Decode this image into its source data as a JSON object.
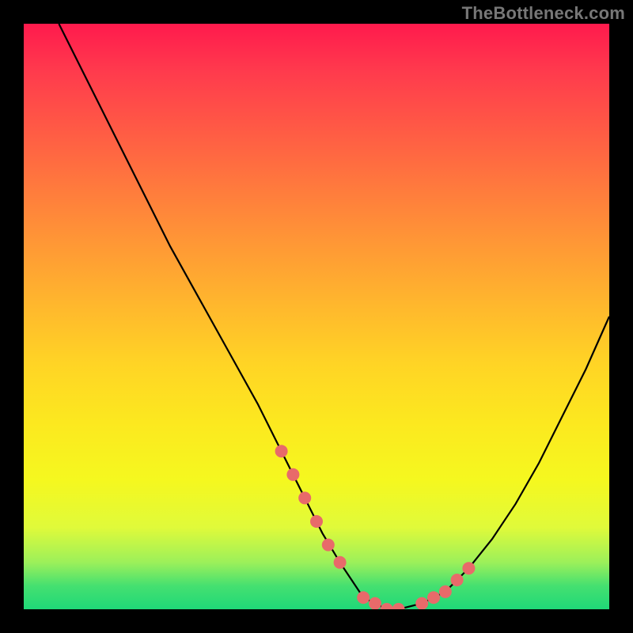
{
  "attribution": "TheBottleneck.com",
  "chart_data": {
    "type": "line",
    "title": "",
    "xlabel": "",
    "ylabel": "",
    "xlim": [
      0,
      100
    ],
    "ylim": [
      0,
      100
    ],
    "series": [
      {
        "name": "curve",
        "x": [
          6,
          10,
          15,
          20,
          25,
          30,
          35,
          40,
          44,
          48,
          51,
          54,
          56,
          58,
          60,
          62,
          64,
          68,
          72,
          76,
          80,
          84,
          88,
          92,
          96,
          100
        ],
        "y": [
          100,
          92,
          82,
          72,
          62,
          53,
          44,
          35,
          27,
          19,
          13,
          8,
          5,
          2,
          1,
          0,
          0,
          1,
          3,
          7,
          12,
          18,
          25,
          33,
          41,
          50
        ]
      }
    ],
    "markers": {
      "name": "highlight-points",
      "color": "#e86a6a",
      "x": [
        44,
        46,
        48,
        50,
        52,
        54,
        58,
        60,
        62,
        64,
        68,
        70,
        72,
        74,
        76
      ],
      "y": [
        27,
        23,
        19,
        15,
        11,
        8,
        2,
        1,
        0,
        0,
        1,
        2,
        3,
        5,
        7
      ]
    }
  },
  "colors": {
    "background": "#000000",
    "curve": "#000000",
    "marker": "#e86a6a"
  }
}
